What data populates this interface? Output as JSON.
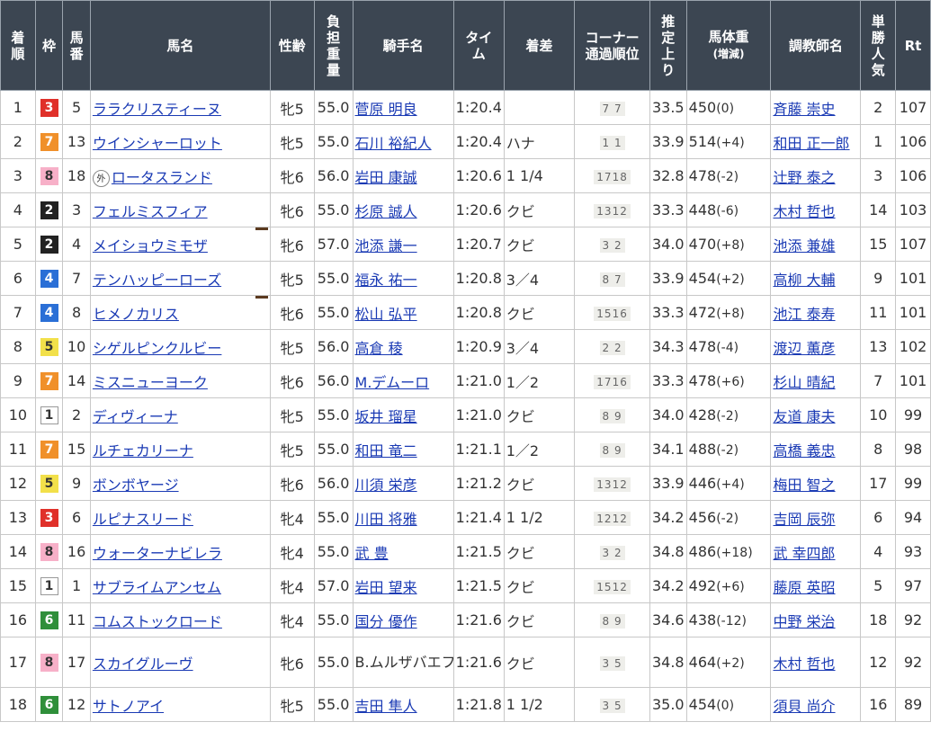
{
  "headers": [
    "着順",
    "枠",
    "馬番",
    "馬名",
    "性齢",
    "負担重量",
    "騎手名",
    "タイム",
    "着差",
    "コーナー通過順位",
    "推定上り",
    "馬体重(増減)",
    "調教師名",
    "単勝人気",
    "Rt"
  ],
  "header_html": {
    "rank": [
      "着",
      "順"
    ],
    "waku": [
      "枠"
    ],
    "umaban": [
      "馬",
      "番"
    ],
    "horse": [
      "馬名"
    ],
    "sexage": [
      "性齢"
    ],
    "weight": [
      "負",
      "担",
      "重",
      "量"
    ],
    "jockey": [
      "騎手名"
    ],
    "time": [
      "タイ",
      "ム"
    ],
    "margin": [
      "着差"
    ],
    "corner": [
      "コーナー",
      "通過順位"
    ],
    "agari": [
      "推",
      "定",
      "上",
      "り"
    ],
    "bodyweight": [
      "馬体重",
      "(増減)"
    ],
    "trainer": [
      "調教師名"
    ],
    "pop": [
      "単",
      "勝",
      "人",
      "気"
    ],
    "rt": [
      "Rt"
    ]
  },
  "rows": [
    {
      "rank": "1",
      "waku": "3",
      "umaban": "5",
      "horse": "ララクリスティーヌ",
      "mark": "",
      "blinker": "",
      "sexage": "牝5",
      "weight": "55.0",
      "jockey": "菅原 明良",
      "time": "1:20.4",
      "margin": "",
      "corner": "7 7",
      "agari": "33.5",
      "bw": "450",
      "bwd": "(0)",
      "trainer": "斉藤 崇史",
      "pop": "2",
      "rt": "107"
    },
    {
      "rank": "2",
      "waku": "7",
      "umaban": "13",
      "horse": "ウインシャーロット",
      "mark": "",
      "blinker": "",
      "sexage": "牝5",
      "weight": "55.0",
      "jockey": "石川 裕紀人",
      "time": "1:20.4",
      "margin": "ハナ",
      "corner": "1 1",
      "agari": "33.9",
      "bw": "514",
      "bwd": "(+4)",
      "trainer": "和田 正一郎",
      "pop": "1",
      "rt": "106"
    },
    {
      "rank": "3",
      "waku": "8",
      "umaban": "18",
      "horse": "ロータスランド",
      "mark": "外",
      "blinker": "",
      "sexage": "牝6",
      "weight": "56.0",
      "jockey": "岩田 康誠",
      "time": "1:20.6",
      "margin": "1 1/4",
      "corner": "1718",
      "agari": "32.8",
      "bw": "478",
      "bwd": "(-2)",
      "trainer": "辻野 泰之",
      "pop": "3",
      "rt": "106"
    },
    {
      "rank": "4",
      "waku": "2",
      "umaban": "3",
      "horse": "フェルミスフィア",
      "mark": "",
      "blinker": "",
      "sexage": "牝6",
      "weight": "55.0",
      "jockey": "杉原 誠人",
      "time": "1:20.6",
      "margin": "クビ",
      "corner": "1312",
      "agari": "33.3",
      "bw": "448",
      "bwd": "(-6)",
      "trainer": "木村 哲也",
      "pop": "14",
      "rt": "103"
    },
    {
      "rank": "5",
      "waku": "2",
      "umaban": "4",
      "horse": "メイショウミモザ",
      "mark": "",
      "blinker": "B",
      "sexage": "牝6",
      "weight": "57.0",
      "jockey": "池添 謙一",
      "time": "1:20.7",
      "margin": "クビ",
      "corner": "3 2",
      "agari": "34.0",
      "bw": "470",
      "bwd": "(+8)",
      "trainer": "池添 兼雄",
      "pop": "15",
      "rt": "107"
    },
    {
      "rank": "6",
      "waku": "4",
      "umaban": "7",
      "horse": "テンハッピーローズ",
      "mark": "",
      "blinker": "",
      "sexage": "牝5",
      "weight": "55.0",
      "jockey": "福永 祐一",
      "time": "1:20.8",
      "margin": "3／4",
      "corner": "8 7",
      "agari": "33.9",
      "bw": "454",
      "bwd": "(+2)",
      "trainer": "高柳 大輔",
      "pop": "9",
      "rt": "101"
    },
    {
      "rank": "7",
      "waku": "4",
      "umaban": "8",
      "horse": "ヒメノカリス",
      "mark": "",
      "blinker": "B",
      "sexage": "牝6",
      "weight": "55.0",
      "jockey": "松山 弘平",
      "time": "1:20.8",
      "margin": "クビ",
      "corner": "1516",
      "agari": "33.3",
      "bw": "472",
      "bwd": "(+8)",
      "trainer": "池江 泰寿",
      "pop": "11",
      "rt": "101"
    },
    {
      "rank": "8",
      "waku": "5",
      "umaban": "10",
      "horse": "シゲルピンクルビー",
      "mark": "",
      "blinker": "",
      "sexage": "牝5",
      "weight": "56.0",
      "jockey": "高倉 稜",
      "time": "1:20.9",
      "margin": "3／4",
      "corner": "2 2",
      "agari": "34.3",
      "bw": "478",
      "bwd": "(-4)",
      "trainer": "渡辺 薫彦",
      "pop": "13",
      "rt": "102"
    },
    {
      "rank": "9",
      "waku": "7",
      "umaban": "14",
      "horse": "ミスニューヨーク",
      "mark": "",
      "blinker": "",
      "sexage": "牝6",
      "weight": "56.0",
      "jockey": "M.デムーロ",
      "time": "1:21.0",
      "margin": "1／2",
      "corner": "1716",
      "agari": "33.3",
      "bw": "478",
      "bwd": "(+6)",
      "trainer": "杉山 晴紀",
      "pop": "7",
      "rt": "101"
    },
    {
      "rank": "10",
      "waku": "1",
      "umaban": "2",
      "horse": "ディヴィーナ",
      "mark": "",
      "blinker": "",
      "sexage": "牝5",
      "weight": "55.0",
      "jockey": "坂井 瑠星",
      "time": "1:21.0",
      "margin": "クビ",
      "corner": "8 9",
      "agari": "34.0",
      "bw": "428",
      "bwd": "(-2)",
      "trainer": "友道 康夫",
      "pop": "10",
      "rt": "99"
    },
    {
      "rank": "11",
      "waku": "7",
      "umaban": "15",
      "horse": "ルチェカリーナ",
      "mark": "",
      "blinker": "",
      "sexage": "牝5",
      "weight": "55.0",
      "jockey": "和田 竜二",
      "time": "1:21.1",
      "margin": "1／2",
      "corner": "8 9",
      "agari": "34.1",
      "bw": "488",
      "bwd": "(-2)",
      "trainer": "高橋 義忠",
      "pop": "8",
      "rt": "98"
    },
    {
      "rank": "12",
      "waku": "5",
      "umaban": "9",
      "horse": "ボンボヤージ",
      "mark": "",
      "blinker": "",
      "sexage": "牝6",
      "weight": "56.0",
      "jockey": "川須 栄彦",
      "time": "1:21.2",
      "margin": "クビ",
      "corner": "1312",
      "agari": "33.9",
      "bw": "446",
      "bwd": "(+4)",
      "trainer": "梅田 智之",
      "pop": "17",
      "rt": "99"
    },
    {
      "rank": "13",
      "waku": "3",
      "umaban": "6",
      "horse": "ルピナスリード",
      "mark": "",
      "blinker": "",
      "sexage": "牝4",
      "weight": "55.0",
      "jockey": "川田 将雅",
      "time": "1:21.4",
      "margin": "1 1/2",
      "corner": "1212",
      "agari": "34.2",
      "bw": "456",
      "bwd": "(-2)",
      "trainer": "吉岡 辰弥",
      "pop": "6",
      "rt": "94"
    },
    {
      "rank": "14",
      "waku": "8",
      "umaban": "16",
      "horse": "ウォーターナビレラ",
      "mark": "",
      "blinker": "",
      "sexage": "牝4",
      "weight": "55.0",
      "jockey": "武 豊",
      "time": "1:21.5",
      "margin": "クビ",
      "corner": "3 2",
      "agari": "34.8",
      "bw": "486",
      "bwd": "(+18)",
      "trainer": "武 幸四郎",
      "pop": "4",
      "rt": "93"
    },
    {
      "rank": "15",
      "waku": "1",
      "umaban": "1",
      "horse": "サブライムアンセム",
      "mark": "",
      "blinker": "",
      "sexage": "牝4",
      "weight": "57.0",
      "jockey": "岩田 望来",
      "time": "1:21.5",
      "margin": "クビ",
      "corner": "1512",
      "agari": "34.2",
      "bw": "492",
      "bwd": "(+6)",
      "trainer": "藤原 英昭",
      "pop": "5",
      "rt": "97"
    },
    {
      "rank": "16",
      "waku": "6",
      "umaban": "11",
      "horse": "コムストックロード",
      "mark": "",
      "blinker": "",
      "sexage": "牝4",
      "weight": "55.0",
      "jockey": "国分 優作",
      "time": "1:21.6",
      "margin": "クビ",
      "corner": "8 9",
      "agari": "34.6",
      "bw": "438",
      "bwd": "(-12)",
      "trainer": "中野 栄治",
      "pop": "18",
      "rt": "92"
    },
    {
      "rank": "17",
      "waku": "8",
      "umaban": "17",
      "horse": "スカイグルーヴ",
      "mark": "",
      "blinker": "",
      "sexage": "牝6",
      "weight": "55.0",
      "jockey": "B.ムルザバエフ",
      "time": "1:21.6",
      "margin": "クビ",
      "corner": "3 5",
      "agari": "34.8",
      "bw": "464",
      "bwd": "(+2)",
      "trainer": "木村 哲也",
      "pop": "12",
      "rt": "92",
      "jockey_link": false,
      "tall": true
    },
    {
      "rank": "18",
      "waku": "6",
      "umaban": "12",
      "horse": "サトノアイ",
      "mark": "",
      "blinker": "",
      "sexage": "牝5",
      "weight": "55.0",
      "jockey": "吉田 隼人",
      "time": "1:21.8",
      "margin": "1 1/2",
      "corner": "3 5",
      "agari": "35.0",
      "bw": "454",
      "bwd": "(0)",
      "trainer": "須貝 尚介",
      "pop": "16",
      "rt": "89"
    }
  ]
}
